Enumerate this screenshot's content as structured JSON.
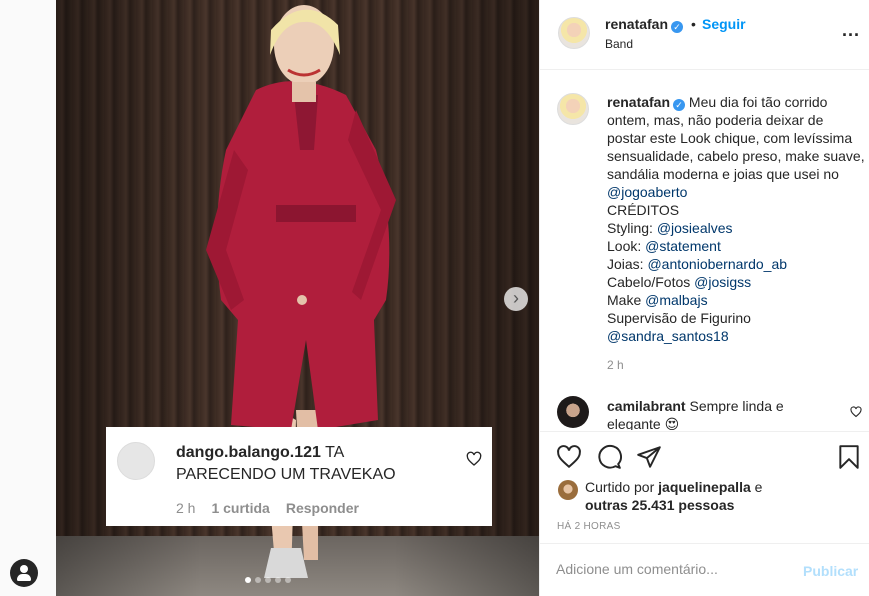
{
  "post": {
    "username": "renatafan",
    "follow_label": "Seguir",
    "bullet": "•",
    "location": "Band",
    "more_label": "..."
  },
  "caption": {
    "username": "renatafan",
    "text1": "Meu dia foi tão corrido ontem, mas, não poderia deixar de postar este Look chique, com levíssima sensualidade, cabelo preso, make suave, sandália moderna e joias que usei no",
    "mention1": "@jogoaberto",
    "credits": "CRÉDITOS",
    "styling_label": "Styling:",
    "styling_mention": "@josiealves",
    "look_label": "Look:",
    "look_mention": "@statement",
    "joias_label": "Joias:",
    "joias_mention": "@antoniobernardo_ab",
    "cabelo_label": "Cabelo/Fotos",
    "cabelo_mention": "@josigss",
    "make_label": "Make",
    "make_mention": "@malbajs",
    "supervisao": "Supervisão de Figurino",
    "supervisao_mention": "@sandra_santos18",
    "time": "2 h"
  },
  "comment": {
    "username": "camilabrant",
    "text": "Sempre linda e elegante",
    "emoji": "😍"
  },
  "overlay_comment": {
    "username": "dango.balango.121",
    "text": "TA PARECENDO UM TRAVEKAO",
    "time": "2 h",
    "likes": "1 curtida",
    "reply": "Responder"
  },
  "likes": {
    "prefix": "Curtido por",
    "user": "jaquelinepalla",
    "middle": "e",
    "others": "outras 25.431 pessoas"
  },
  "timeago": "HÁ 2 HORAS",
  "add_comment": {
    "placeholder": "Adicione um comentário...",
    "publish_label": "Publicar"
  },
  "carousel": {
    "total_dots": 5,
    "active_index": 0
  },
  "colors": {
    "link": "#00376b",
    "accent": "#0095f6",
    "publish_disabled": "#b2dffc",
    "dress": "#b01e3c"
  }
}
